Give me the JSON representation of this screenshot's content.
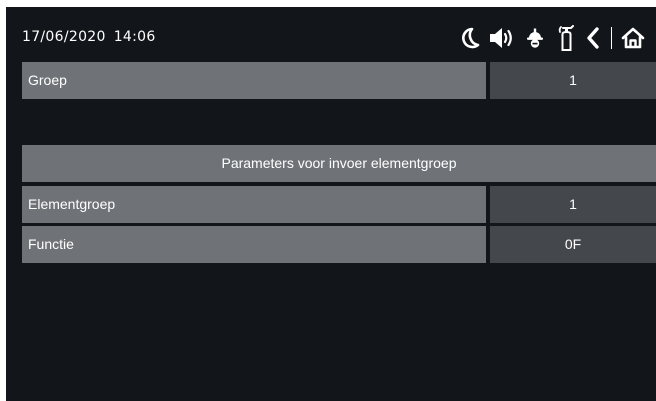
{
  "status_bar": {
    "date": "17/06/2020",
    "time": "14:06",
    "icons": [
      "moon-icon",
      "speaker-icon",
      "firefighter-helmet-icon",
      "fire-extinguisher-icon",
      "back-chevron-icon",
      "home-icon"
    ]
  },
  "group_row": {
    "label": "Groep",
    "value": "1"
  },
  "section": {
    "title": "Parameters voor invoer elementgroep",
    "rows": [
      {
        "label": "Elementgroep",
        "value": "1"
      },
      {
        "label": "Functie",
        "value": "0F"
      }
    ]
  },
  "colors": {
    "background": "#12151a",
    "label_cell": "#6f7377",
    "value_cell": "#44474b",
    "text": "#ffffff"
  }
}
